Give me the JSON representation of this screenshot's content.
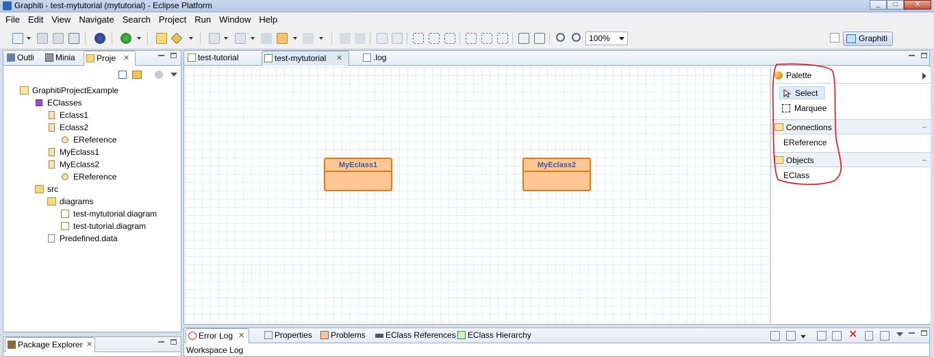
{
  "window": {
    "title": "Graphiti - test-mytutorial (mytutorial) - Eclipse Platform",
    "buttons": [
      "_",
      "□",
      "X"
    ]
  },
  "menu": [
    "File",
    "Edit",
    "View",
    "Navigate",
    "Search",
    "Project",
    "Run",
    "Window",
    "Help"
  ],
  "toolbar": {
    "zoom": "100%",
    "perspective": "Graphiti"
  },
  "left_panel": {
    "tabs": [
      "Outli",
      "Minia",
      "Proje"
    ],
    "active_tab": "Proje",
    "tree": [
      {
        "label": "GraphitiProjectExample",
        "icon": "folder-open-icon"
      },
      {
        "label": "EClasses",
        "icon": "package-icon"
      },
      {
        "label": "Eclass1",
        "icon": "eclass-icon"
      },
      {
        "label": "Eclass2",
        "icon": "eclass-icon"
      },
      {
        "label": "EReference",
        "icon": "ereference-icon"
      },
      {
        "label": "MyEclass1",
        "icon": "eclass-icon"
      },
      {
        "label": "MyEclass2",
        "icon": "eclass-icon"
      },
      {
        "label": "EReference",
        "icon": "ereference-icon"
      },
      {
        "label": "src",
        "icon": "folder-icon"
      },
      {
        "label": "diagrams",
        "icon": "folder-icon"
      },
      {
        "label": "test-mytutorial.diagram",
        "icon": "diagram-file-icon"
      },
      {
        "label": "test-tutorial.diagram",
        "icon": "diagram-file-icon"
      },
      {
        "label": "Predefined.data",
        "icon": "file-icon"
      }
    ]
  },
  "package_explorer": {
    "label": "Package Explorer"
  },
  "editor": {
    "tabs": [
      "test-tutorial",
      "test-mytutorial",
      ".log"
    ],
    "active_tab": "test-mytutorial",
    "shapes": [
      "MyEclass1",
      "MyEclass2"
    ]
  },
  "palette": {
    "title": "Palette",
    "tools": [
      "Select",
      "Marquee"
    ],
    "selected_tool": "Select",
    "drawers": [
      {
        "label": "Connections",
        "entries": [
          "EReference"
        ]
      },
      {
        "label": "Objects",
        "entries": [
          "EClass"
        ]
      }
    ],
    "annotation_color": "#e0101a"
  },
  "bottom_panel": {
    "tabs": [
      "Error Log",
      "Properties",
      "Problems",
      "EClass References",
      "EClass Hierarchy"
    ],
    "active_tab": "Error Log",
    "subtitle": "Workspace Log"
  },
  "colors": {
    "eclass_fill": "#fec793",
    "eclass_border": "#e57a13",
    "eclass_text": "#3c5aa6",
    "grid": "#e3ecf4"
  }
}
